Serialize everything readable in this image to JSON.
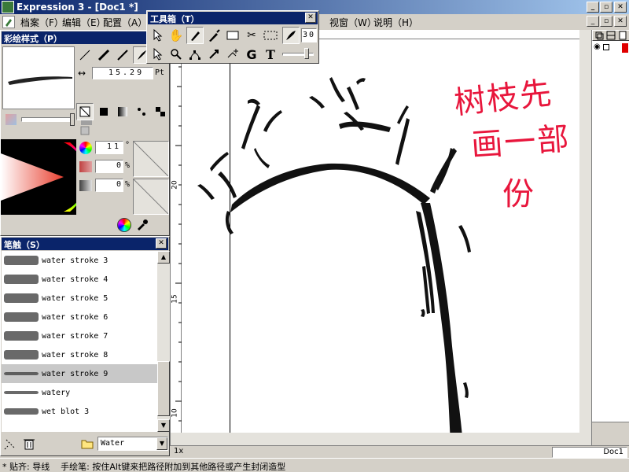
{
  "app": {
    "title": "Expression 3 - [Doc1 *]"
  },
  "menu": {
    "items": [
      "档案（F）",
      "编辑（E）",
      "配置（A）",
      "视窗（W）",
      "说明（H）"
    ]
  },
  "toolbox": {
    "title": "工具箱（T）",
    "stroke_width_value": "30"
  },
  "style_panel": {
    "title": "彩绘样式（P）",
    "spacing_value": "15.29",
    "spacing_unit": "Pt",
    "angle_value": "11",
    "angle_unit": "°",
    "percent_1": "0",
    "percent_2": "0",
    "percent_unit": "%"
  },
  "brush_panel": {
    "title": "笔触（S）",
    "items": [
      "water stroke 3",
      "water stroke 4",
      "water stroke 5",
      "water stroke 6",
      "water stroke 7",
      "water stroke 8",
      "water stroke 9",
      "watery",
      "wet blot 3"
    ],
    "selected_index": 6,
    "category": "Water"
  },
  "ruler": {
    "vertical_labels": [
      "20",
      "15",
      "10"
    ]
  },
  "canvas": {
    "handwriting_line1": "树枝先",
    "handwriting_line2": "画一部",
    "handwriting_line3": "份"
  },
  "status": {
    "zoom": "1x",
    "doc_tab": "Doc1",
    "hint": "* 贴齐: 导线    手绘笔: 按住Alt键来把路径附加到其他路径或产生封闭造型"
  },
  "colors": {
    "title_bar": "#0a246a",
    "handwriting": "#e8163c"
  }
}
